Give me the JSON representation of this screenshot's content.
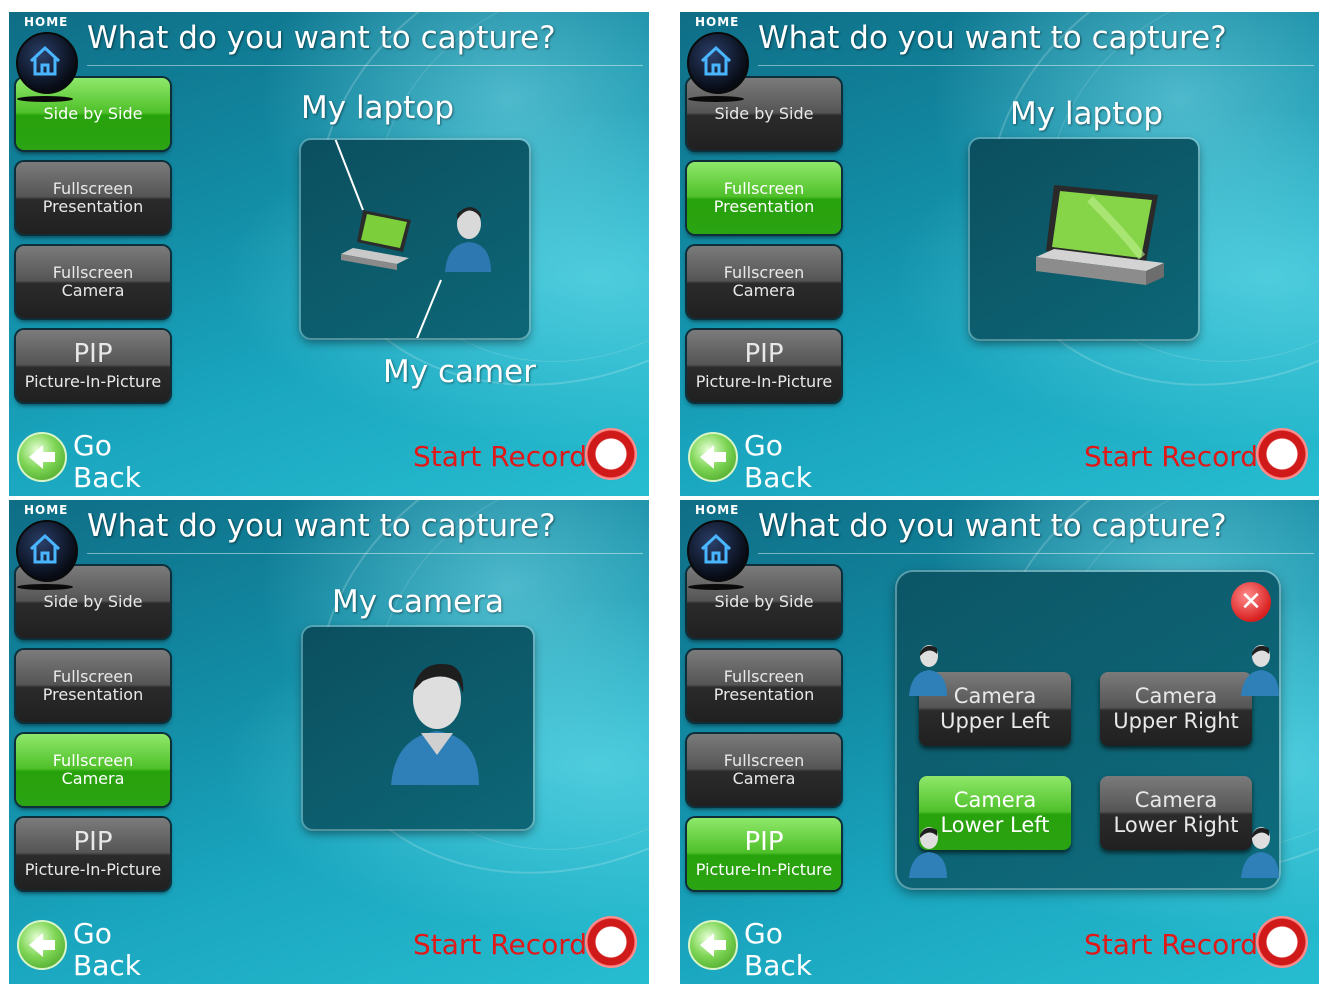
{
  "common": {
    "home_label": "HOME",
    "title": "What do you want to capture?",
    "buttons": {
      "side_by_side": "Side by Side",
      "fullscreen": "Fullscreen",
      "presentation": "Presentation",
      "camera": "Camera",
      "pip": "PIP",
      "pip_sub": "Picture-In-Picture"
    },
    "go": "Go",
    "back": "Back",
    "start_record": "Start Record"
  },
  "panels": [
    {
      "active": "side_by_side",
      "captions": [
        "My laptop",
        "My camer"
      ]
    },
    {
      "active": "fullscreen_presentation",
      "captions": [
        "My laptop"
      ]
    },
    {
      "active": "fullscreen_camera",
      "captions": [
        "My camera"
      ]
    },
    {
      "active": "pip",
      "captions": []
    }
  ],
  "pip_dialog": {
    "close": "✕",
    "upper_left": [
      "Camera",
      "Upper Left"
    ],
    "upper_right": [
      "Camera",
      "Upper Right"
    ],
    "lower_left": [
      "Camera",
      "Lower Left"
    ],
    "lower_right": [
      "Camera",
      "Lower Right"
    ],
    "selected": "lower_left"
  },
  "icons": {
    "home": "home-icon",
    "back": "left-arrow-icon",
    "record": "record-icon",
    "laptop": "laptop-icon",
    "person": "person-icon",
    "close": "close-icon"
  },
  "colors": {
    "active_button": "#3cb318",
    "record_text": "#e01818",
    "background": "#1690aa"
  }
}
